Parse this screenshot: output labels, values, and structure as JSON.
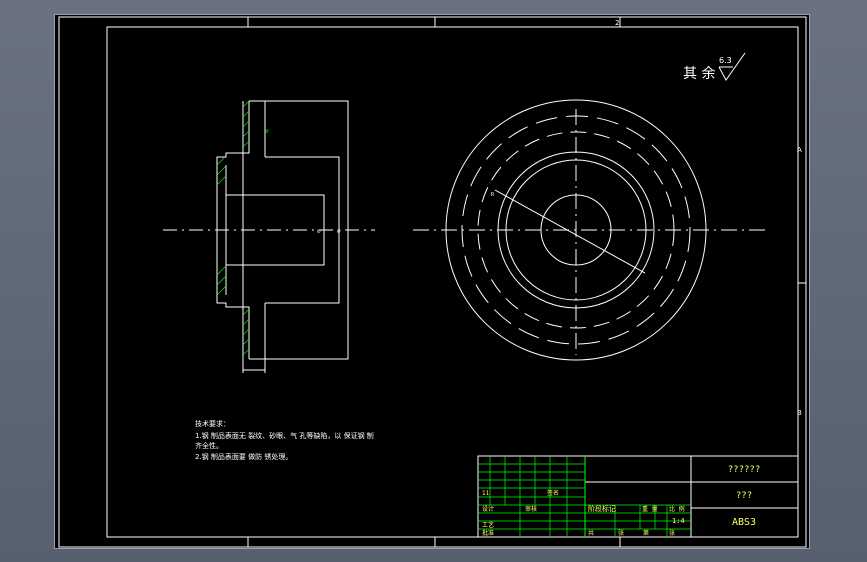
{
  "drawing": {
    "border_zone_top": [
      "1",
      "2"
    ],
    "border_zone_right": [
      "A",
      "B"
    ],
    "surface_finish": {
      "label": "其 余",
      "roughness": "6.3"
    },
    "tech_requirements": {
      "heading": "技术要求：",
      "items": [
        "1.钢 制品表面无 裂纹、砂眼、气 孔等缺陷，以 保证钢 制",
        "齐全性。",
        "2.钢 制品表面要 做防 锈处理。"
      ]
    },
    "title_block": {
      "part_name": "??????",
      "subtitle": "???",
      "material": "ABS3",
      "cells": [
        "11",
        "标记",
        "审核",
        "签名",
        "设计",
        "工艺",
        "批准",
        "阶段标记",
        "重 量",
        "比 例",
        "1:4",
        "共",
        "张",
        "第",
        "张"
      ]
    },
    "dimension_labels": [
      "∅",
      "R"
    ]
  },
  "colors": {
    "background": "#000000",
    "lines": "#ffffff",
    "dims": "#00ff00",
    "grid": "#00ff00",
    "text_yellow": "#ffff66"
  }
}
